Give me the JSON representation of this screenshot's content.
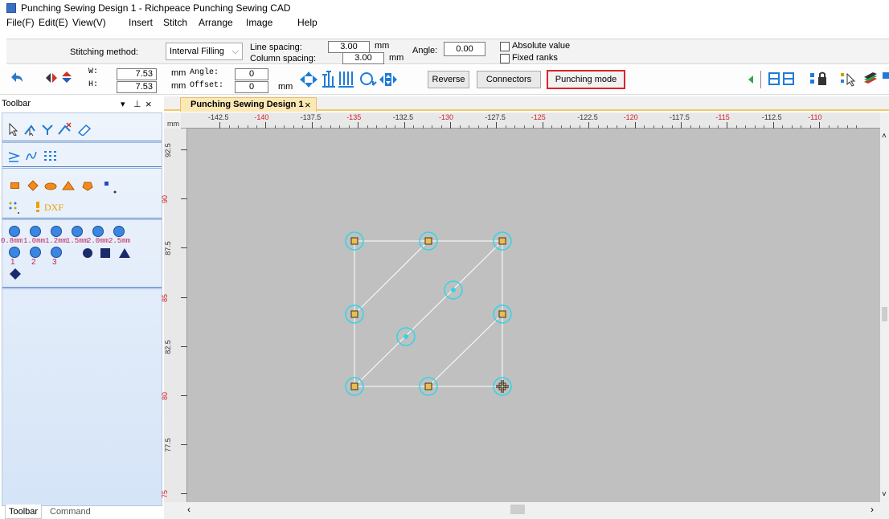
{
  "app": {
    "title": "Punching Sewing Design 1 - Richpeace Punching Sewing CAD"
  },
  "menu": [
    "File(F)",
    "Edit(E)",
    "View(V)",
    "Insert",
    "Stitch",
    "Arrange",
    "Image",
    "Help"
  ],
  "properties": {
    "stitching_method_label": "Stitching method:",
    "stitching_method_value": "Interval Filling",
    "line_spacing_label": "Line spacing:",
    "line_spacing_value": "3.00",
    "column_spacing_label": "Column spacing:",
    "column_spacing_value": "3.00",
    "unit_mm": "mm",
    "angle_label": "Angle:",
    "angle_value": "0.00",
    "absolute_value_label": "Absolute value",
    "fixed_ranks_label": "Fixed ranks"
  },
  "sizebar": {
    "w_label": "W:",
    "w_value": "7.53",
    "h_label": "H:",
    "h_value": "7.53",
    "mm": "mm",
    "angle_label": "Angle:",
    "angle_value": "0",
    "offset_label": "Offset:",
    "offset_value": "0",
    "reverse_label": "Reverse",
    "connectors_label": "Connectors",
    "punching_mode_label": "Punching mode"
  },
  "toolbar_panel": {
    "title": "Toolbar",
    "dxf_label": "DXF",
    "size_labels": [
      "0.8mm",
      "1.0mm",
      "1.2mm",
      "1.5mm",
      "2.0mm",
      "2.5mm"
    ],
    "numbered_labels": [
      "1",
      "2",
      "3"
    ],
    "tabs": [
      "Toolbar",
      "Command"
    ]
  },
  "document": {
    "tab_title": "Punching Sewing Design 1",
    "close_glyph": "×"
  },
  "ruler": {
    "unit": "mm",
    "h_ticks": [
      {
        "label": "-142.5",
        "red": false
      },
      {
        "label": "-140",
        "red": true
      },
      {
        "label": "-137.5",
        "red": false
      },
      {
        "label": "-135",
        "red": true
      },
      {
        "label": "-132.5",
        "red": false
      },
      {
        "label": "-130",
        "red": true
      },
      {
        "label": "-127.5",
        "red": false
      },
      {
        "label": "-125",
        "red": true
      },
      {
        "label": "-122.5",
        "red": false
      },
      {
        "label": "-120",
        "red": true
      },
      {
        "label": "-117.5",
        "red": false
      },
      {
        "label": "-115",
        "red": true
      },
      {
        "label": "-112.5",
        "red": false
      },
      {
        "label": "-110",
        "red": true
      }
    ],
    "v_ticks": [
      {
        "label": "92.5",
        "red": false
      },
      {
        "label": "90",
        "red": true
      },
      {
        "label": "87.5",
        "red": false
      },
      {
        "label": "85",
        "red": true
      },
      {
        "label": "82.5",
        "red": false
      },
      {
        "label": "80",
        "red": true
      },
      {
        "label": "77.5",
        "red": false
      },
      {
        "label": "75",
        "red": true
      }
    ]
  },
  "colors": {
    "accent_highlight": "#d9262b",
    "node_ring": "#2fd6e6",
    "node_fill": "#e8c04a",
    "canvas_bg": "#c0c0c0",
    "stitch_line": "#ffffff"
  }
}
